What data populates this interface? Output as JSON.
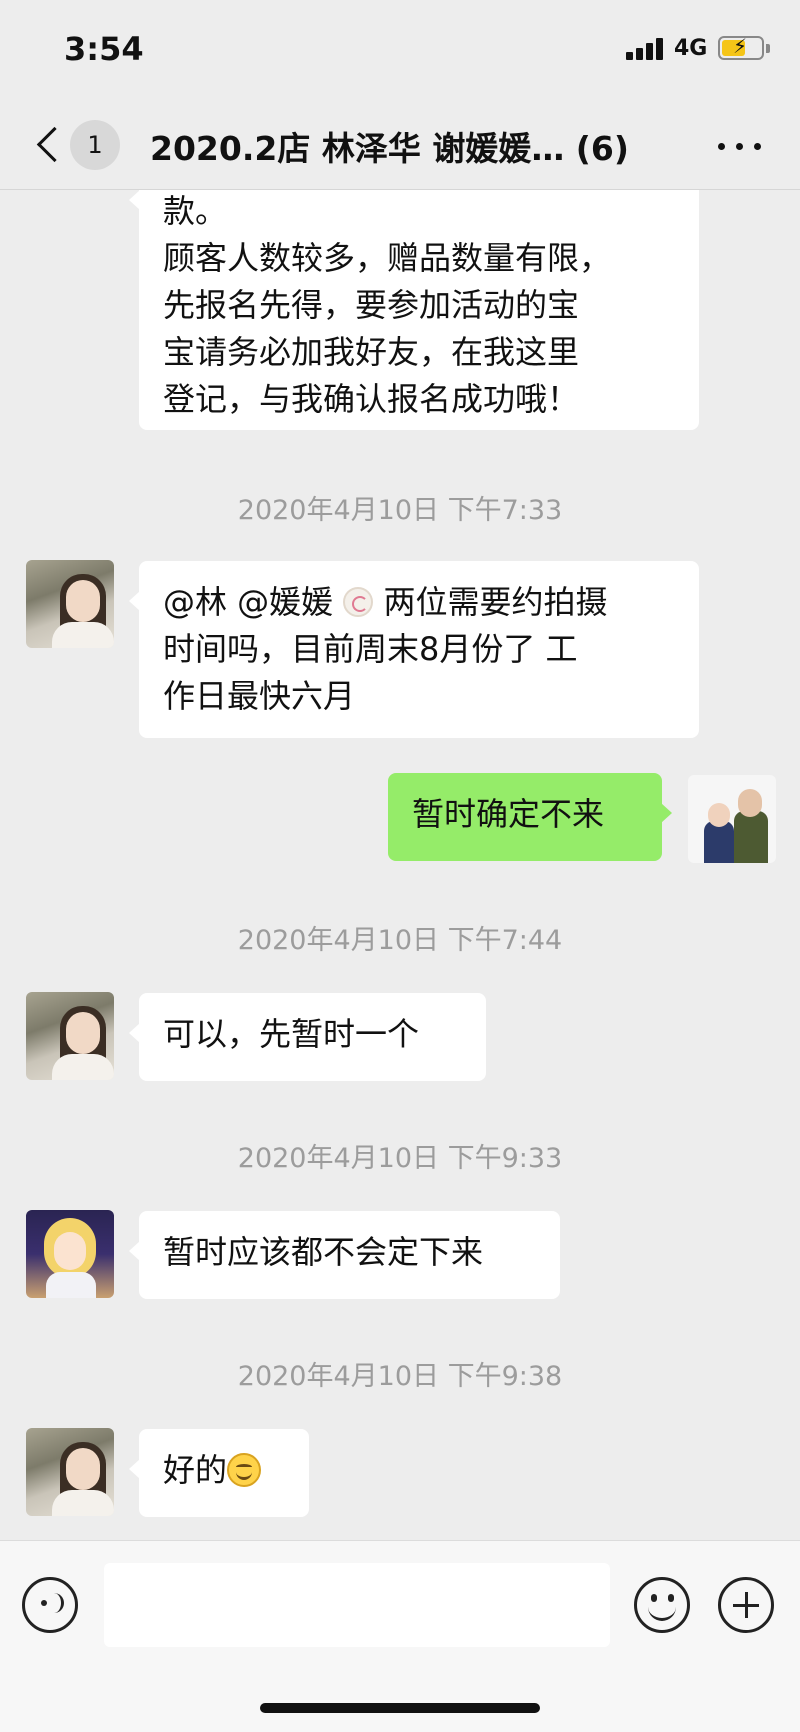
{
  "status_bar": {
    "time": "3:54",
    "network": "4G",
    "battery_level": 0.6,
    "battery_color": "#f5c518"
  },
  "nav": {
    "back_icon": "chevron-left-icon",
    "unread_count": "1",
    "title": "2020.2店 林泽华 谢媛媛…  (6)",
    "more_icon": "ellipsis-icon"
  },
  "messages": [
    {
      "side": "left",
      "lines": [
        "款。",
        "顾客人数较多，赠品数量有限，",
        "先报名先得，要参加活动的宝",
        "宝请务必加我好友，在我这里",
        "登记，与我确认报名成功哦！"
      ]
    },
    {
      "timestamp": "2020年4月10日 下午7:33"
    },
    {
      "side": "left",
      "sender": "avatar-a",
      "lines": [
        "@林 @媛媛",
        " 两位需要约拍摄",
        "时间吗，目前周末8月份了 工",
        "作日最快六月"
      ]
    },
    {
      "side": "right",
      "sender": "avatar-self",
      "lines": [
        "暂时确定不来"
      ]
    },
    {
      "timestamp": "2020年4月10日 下午7:44"
    },
    {
      "side": "left",
      "sender": "avatar-a",
      "lines": [
        "可以，先暂时一个"
      ]
    },
    {
      "timestamp": "2020年4月10日 下午9:33"
    },
    {
      "side": "left",
      "sender": "avatar-b",
      "lines": [
        "暂时应该都不会定下来"
      ]
    },
    {
      "timestamp": "2020年4月10日 下午9:38"
    },
    {
      "side": "left",
      "sender": "avatar-a",
      "lines": [
        "好的"
      ]
    }
  ],
  "input_bar": {
    "placeholder": "",
    "voice_icon": "voice-icon",
    "emoji_icon": "emoji-icon",
    "plus_icon": "plus-icon"
  },
  "colors": {
    "background": "#ededed",
    "incoming_bubble": "#ffffff",
    "outgoing_bubble": "#95ec69",
    "timestamp_text": "#9c9c9c"
  }
}
